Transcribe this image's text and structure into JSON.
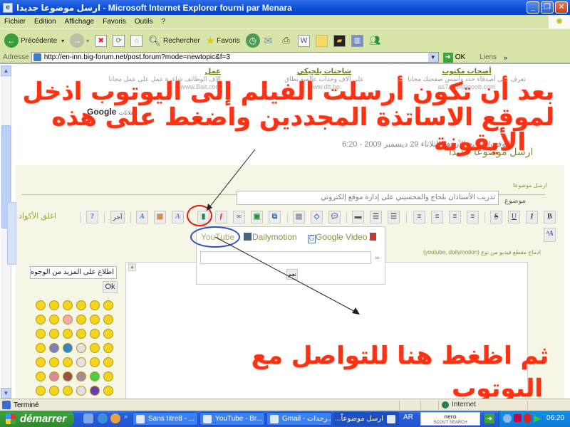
{
  "window": {
    "title": "ارسل موضوعا جديدا - Microsoft Internet Explorer fourni par Menara",
    "minimize_label": "_",
    "maximize_label": "❐",
    "close_label": "✕"
  },
  "menubar": {
    "items": [
      "Fichier",
      "Edition",
      "Affichage",
      "Favoris",
      "Outils",
      "?"
    ]
  },
  "toolbar": {
    "back_label": "Précédente",
    "search_label": "Rechercher",
    "favorites_label": "Favoris"
  },
  "addressbar": {
    "label": "Adresse",
    "url": "http://en-inn.big-forum.net/post.forum?mode=newtopic&f=3",
    "go_label": "OK",
    "links_label": "Liens"
  },
  "ads": [
    {
      "title": "أصحاب مكتوب",
      "desc": "تعرف على أصدقاء جدد وأسس صفحتك مجانا",
      "url": "as7ab.maktoob.com"
    },
    {
      "title": "شاحنات بلجيكي",
      "desc": "على آلاف وحدات عالمية نطاق",
      "url": "www.dtt.be"
    },
    {
      "title": "عمل",
      "desc": "الاف الوظائف شاغرة عمل على عمل مجانا",
      "url": "www.Bait.com"
    }
  ],
  "google_ads_label": "Google",
  "google_ads_prefix": "إعلانات",
  "datetime": "الوقت/التاريخ الآن هو الثلاثاء 29 ديسمبر 2009 - 6:20",
  "page_title": "ارسل موضوعا جديدا",
  "form": {
    "header_label": "ارسل موضوعا",
    "subject_label": "موضوع",
    "subject_value": "تدريب الأستاذان بلحاج والمحسيني على إدارة موقع إلكتروني",
    "close_codes_label": "اغلق الأكواد",
    "other_label": "آخر",
    "embed_hint": "ادماج مقطع فيديو من نوع (youtube, dailymotion)",
    "editor_buttons": [
      "B",
      "I",
      "U",
      "S",
      "align-left",
      "align-center",
      "align-right",
      "justify",
      "bullet-list",
      "numbered-list",
      "hr",
      "quote",
      "code",
      "spoiler",
      "image",
      "url",
      "flash",
      "video",
      "color",
      "highlight",
      "font",
      "help"
    ]
  },
  "emoticons": {
    "search_value": "اطلاع على المزيد من الوجوه المعبرة",
    "ok_label": "Ok"
  },
  "video_popup": {
    "tabs": [
      "YouTube",
      "Dailymotion",
      "Google Video"
    ],
    "url_value": "",
    "submit_label": "نعم"
  },
  "annotations": {
    "top": [
      "بعد أن تكون أرسلت الفيلم إلى اليوتوب اذخل",
      "لموقع الاساتذة المجددين واضغط على هذه",
      "الأيقونة"
    ],
    "bottom": [
      "ثم اظغط هنا للتواصل مع",
      "اليوتوب"
    ],
    "highlight_colors": {
      "text": "#ff3112",
      "icon_circle": "#e01a1a",
      "tab_circle": "#2850c8"
    }
  },
  "statusbar": {
    "text": "Terminé",
    "zone": "Internet"
  },
  "taskbar": {
    "start_label": "démarrer",
    "tasks": [
      "Sans titre8 - ...",
      "YouTube - Br...",
      "Gmail - رحدات...",
      "ارسل موضوعاً..."
    ],
    "lang": "AR",
    "nero_label": "nero",
    "nero_sub": "SCOUT SEARCH",
    "clock": "06:20"
  }
}
